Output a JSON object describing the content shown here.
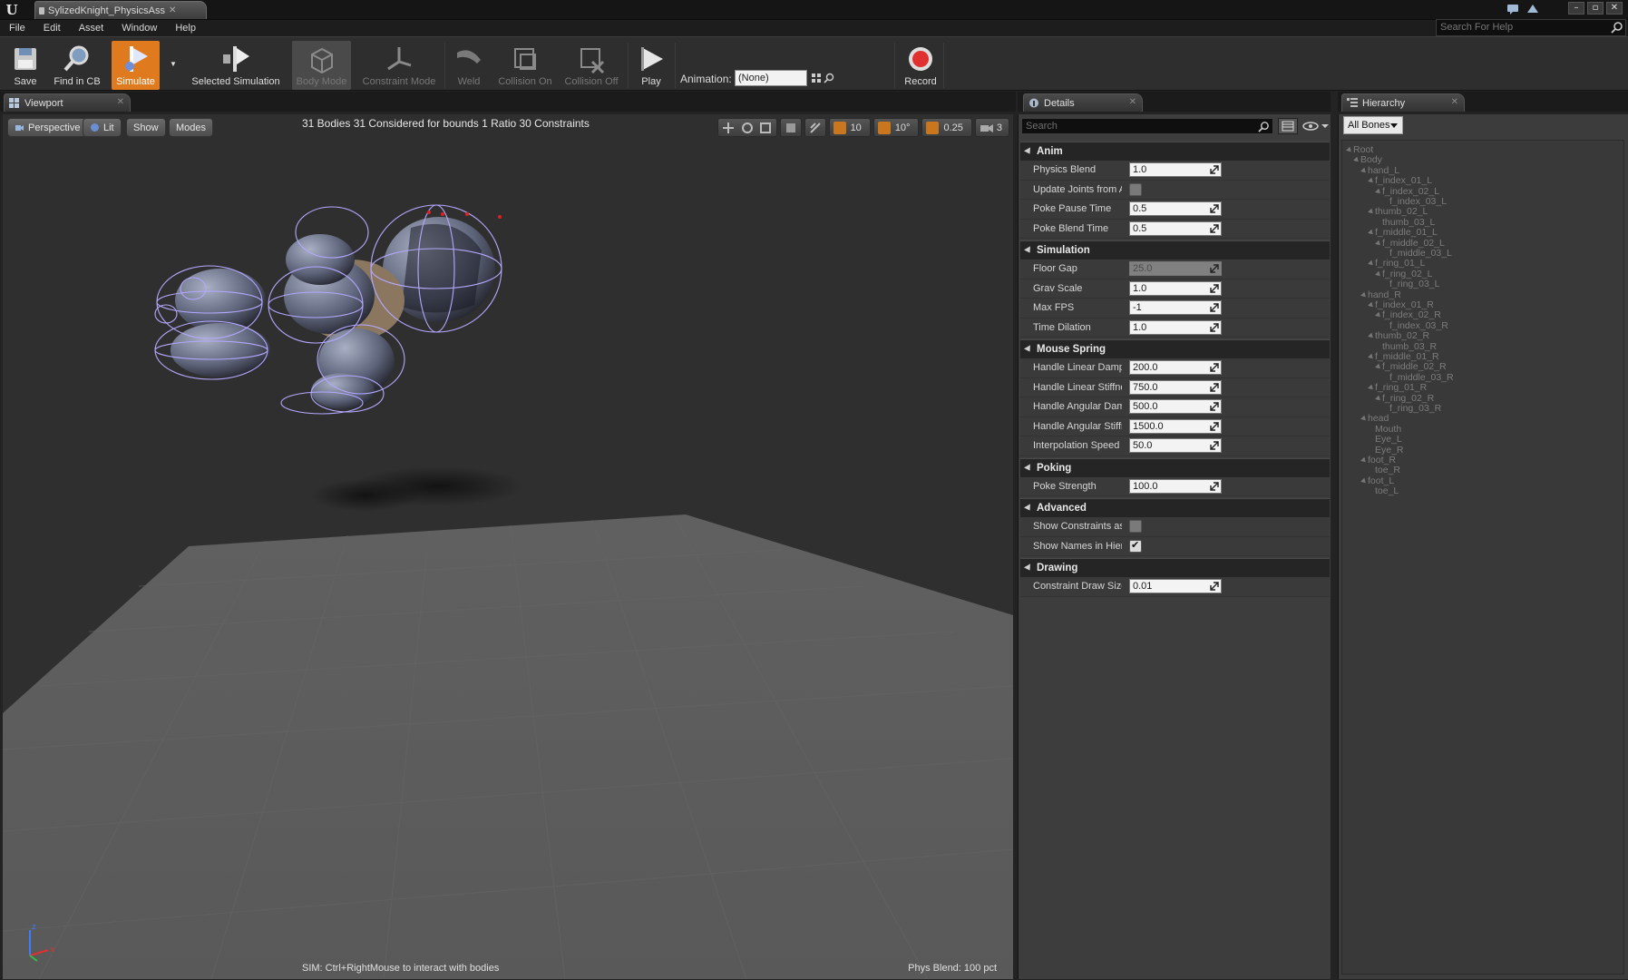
{
  "title_bar": {
    "asset_tab": "SylizedKnight_PhysicsAss"
  },
  "menu": {
    "items": [
      "File",
      "Edit",
      "Asset",
      "Window",
      "Help"
    ],
    "help_search_placeholder": "Search For Help"
  },
  "toolbar": {
    "buttons": [
      {
        "label": "Save"
      },
      {
        "label": "Find in CB"
      },
      {
        "label": "Simulate"
      },
      {
        "label": "Selected Simulation"
      },
      {
        "label": "Body Mode"
      },
      {
        "label": "Constraint Mode"
      },
      {
        "label": "Weld"
      },
      {
        "label": "Collision On"
      },
      {
        "label": "Collision Off"
      },
      {
        "label": "Play"
      },
      {
        "label": "Record"
      }
    ],
    "animation_label": "Animation:",
    "animation_value": "(None)"
  },
  "viewport": {
    "tab_label": "Viewport",
    "perspective_label": "Perspective",
    "lit_label": "Lit",
    "show_label": "Show",
    "modes_label": "Modes",
    "stats": "31 Bodies  31 Considered for bounds  1 Ratio  30 Constraints",
    "grid_snap_value": "10",
    "rotation_snap_value": "10°",
    "scale_snap_value": "0.25",
    "camera_speed_value": "3",
    "hint_text": "SIM: Ctrl+RightMouse to interact with bodies",
    "phys_blend_text": "Phys Blend: 100 pct"
  },
  "details": {
    "tab_label": "Details",
    "search_placeholder": "Search",
    "categories": [
      {
        "name": "Anim",
        "props": [
          {
            "label": "Physics Blend",
            "type": "num",
            "value": "1.0"
          },
          {
            "label": "Update Joints from Animation",
            "type": "bool",
            "checked": false
          },
          {
            "label": "Poke Pause Time",
            "type": "num",
            "value": "0.5"
          },
          {
            "label": "Poke Blend Time",
            "type": "num",
            "value": "0.5"
          }
        ]
      },
      {
        "name": "Simulation",
        "props": [
          {
            "label": "Floor Gap",
            "type": "num",
            "value": "25.0",
            "disabled": true
          },
          {
            "label": "Grav Scale",
            "type": "num",
            "value": "1.0"
          },
          {
            "label": "Max FPS",
            "type": "num",
            "value": "-1"
          },
          {
            "label": "Time Dilation",
            "type": "num",
            "value": "1.0"
          }
        ]
      },
      {
        "name": "Mouse Spring",
        "props": [
          {
            "label": "Handle Linear Damping",
            "type": "num",
            "value": "200.0"
          },
          {
            "label": "Handle Linear Stiffness",
            "type": "num",
            "value": "750.0"
          },
          {
            "label": "Handle Angular Damping",
            "type": "num",
            "value": "500.0"
          },
          {
            "label": "Handle Angular Stiffness",
            "type": "num",
            "value": "1500.0"
          },
          {
            "label": "Interpolation Speed",
            "type": "num",
            "value": "50.0"
          }
        ]
      },
      {
        "name": "Poking",
        "props": [
          {
            "label": "Poke Strength",
            "type": "num",
            "value": "100.0"
          }
        ]
      },
      {
        "name": "Advanced",
        "props": [
          {
            "label": "Show Constraints as Rectangles",
            "type": "bool",
            "checked": false
          },
          {
            "label": "Show Names in Hierarchy",
            "type": "bool",
            "checked": true
          }
        ]
      },
      {
        "name": "Drawing",
        "props": [
          {
            "label": "Constraint Draw Size",
            "type": "num",
            "value": "0.01"
          }
        ]
      }
    ]
  },
  "hierarchy": {
    "tab_label": "Hierarchy",
    "filter_value": "All Bones",
    "bones": [
      {
        "name": "Root",
        "depth": 0,
        "arrow": true
      },
      {
        "name": "Body",
        "depth": 1,
        "arrow": true
      },
      {
        "name": "hand_L",
        "depth": 2,
        "arrow": true
      },
      {
        "name": "f_index_01_L",
        "depth": 3,
        "arrow": true
      },
      {
        "name": "f_index_02_L",
        "depth": 4,
        "arrow": true
      },
      {
        "name": "f_index_03_L",
        "depth": 5,
        "arrow": false
      },
      {
        "name": "thumb_02_L",
        "depth": 3,
        "arrow": true
      },
      {
        "name": "thumb_03_L",
        "depth": 4,
        "arrow": false
      },
      {
        "name": "f_middle_01_L",
        "depth": 3,
        "arrow": true
      },
      {
        "name": "f_middle_02_L",
        "depth": 4,
        "arrow": true
      },
      {
        "name": "f_middle_03_L",
        "depth": 5,
        "arrow": false
      },
      {
        "name": "f_ring_01_L",
        "depth": 3,
        "arrow": true
      },
      {
        "name": "f_ring_02_L",
        "depth": 4,
        "arrow": true
      },
      {
        "name": "f_ring_03_L",
        "depth": 5,
        "arrow": false
      },
      {
        "name": "hand_R",
        "depth": 2,
        "arrow": true
      },
      {
        "name": "f_index_01_R",
        "depth": 3,
        "arrow": true
      },
      {
        "name": "f_index_02_R",
        "depth": 4,
        "arrow": true
      },
      {
        "name": "f_index_03_R",
        "depth": 5,
        "arrow": false
      },
      {
        "name": "thumb_02_R",
        "depth": 3,
        "arrow": true
      },
      {
        "name": "thumb_03_R",
        "depth": 4,
        "arrow": false
      },
      {
        "name": "f_middle_01_R",
        "depth": 3,
        "arrow": true
      },
      {
        "name": "f_middle_02_R",
        "depth": 4,
        "arrow": true
      },
      {
        "name": "f_middle_03_R",
        "depth": 5,
        "arrow": false
      },
      {
        "name": "f_ring_01_R",
        "depth": 3,
        "arrow": true
      },
      {
        "name": "f_ring_02_R",
        "depth": 4,
        "arrow": true
      },
      {
        "name": "f_ring_03_R",
        "depth": 5,
        "arrow": false
      },
      {
        "name": "head",
        "depth": 2,
        "arrow": true
      },
      {
        "name": "Mouth",
        "depth": 3,
        "arrow": false
      },
      {
        "name": "Eye_L",
        "depth": 3,
        "arrow": false
      },
      {
        "name": "Eye_R",
        "depth": 3,
        "arrow": false
      },
      {
        "name": "foot_R",
        "depth": 2,
        "arrow": true
      },
      {
        "name": "toe_R",
        "depth": 3,
        "arrow": false
      },
      {
        "name": "foot_L",
        "depth": 2,
        "arrow": true
      },
      {
        "name": "toe_L",
        "depth": 3,
        "arrow": false
      }
    ]
  },
  "colors": {
    "accent": "#e07a1f",
    "panel_bg": "#3d3d3d",
    "viewport_bg": "#2f2f2f",
    "floor": "#5a5a5a",
    "physics_body_wire": "#b4a8ff"
  }
}
